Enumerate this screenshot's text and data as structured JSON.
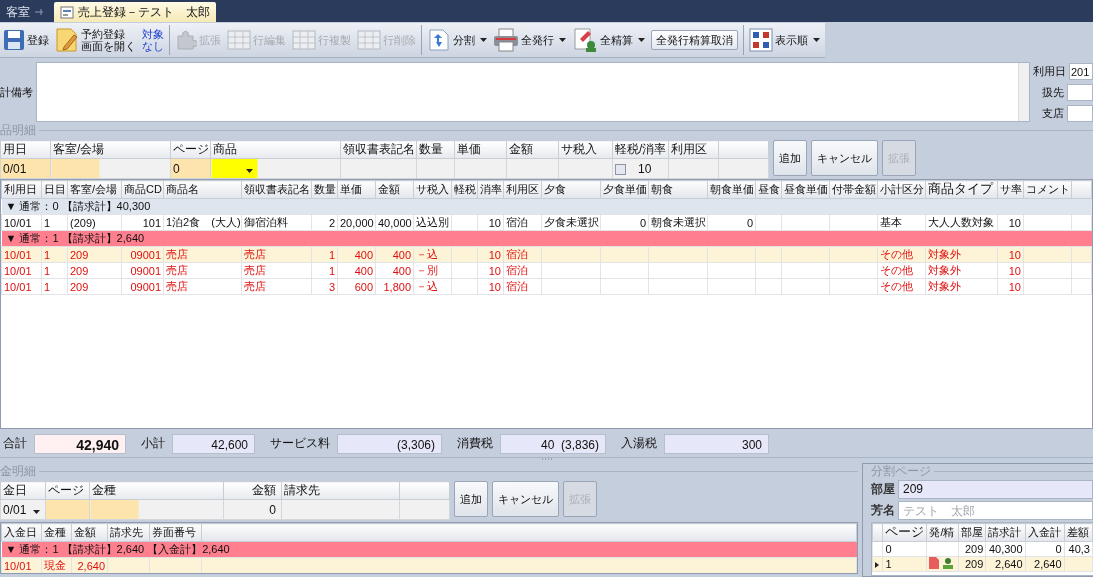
{
  "tabs": [
    {
      "label": "客室",
      "selected": false
    },
    {
      "label": "売上登録－テスト　太郎",
      "selected": true
    }
  ],
  "toolbar": [
    {
      "kind": "icon",
      "lines": [
        "登録"
      ],
      "disabled": false,
      "dropdown": false
    },
    {
      "kind": "icon",
      "lines": [
        "予約登録",
        "画面を開く"
      ],
      "disabled": false,
      "dropdown": false
    },
    {
      "kind": "text",
      "lines": [
        "対象",
        "なし"
      ],
      "disabled": false,
      "dropdown": false
    },
    {
      "kind": "icon",
      "lines": [
        "拡張"
      ],
      "disabled": true,
      "dropdown": false
    },
    {
      "kind": "icon",
      "lines": [
        "行編集"
      ],
      "disabled": true,
      "dropdown": false
    },
    {
      "kind": "icon",
      "lines": [
        "行複製"
      ],
      "disabled": true,
      "dropdown": false
    },
    {
      "kind": "icon",
      "lines": [
        "行削除"
      ],
      "disabled": true,
      "dropdown": false
    },
    {
      "kind": "icon",
      "lines": [
        "分割"
      ],
      "disabled": false,
      "dropdown": true
    },
    {
      "kind": "icon",
      "lines": [
        "全発行"
      ],
      "disabled": false,
      "dropdown": true
    },
    {
      "kind": "icon",
      "lines": [
        "全精算"
      ],
      "disabled": false,
      "dropdown": true
    },
    {
      "kind": "button",
      "lines": [
        "全発行精算取消"
      ],
      "disabled": false,
      "dropdown": false
    },
    {
      "kind": "icon",
      "lines": [
        "表示順"
      ],
      "disabled": false,
      "dropdown": true
    }
  ],
  "memo": {
    "label": "計備考",
    "side_fields": [
      {
        "label": "利用日",
        "value": "201"
      },
      {
        "label": "扱先"
      },
      {
        "label": "支店"
      }
    ]
  },
  "item_entry": {
    "section": "品明細",
    "columns": [
      {
        "label": "用日",
        "value": "0/01",
        "kind": "required"
      },
      {
        "label": "客室/会場",
        "kind": "partial"
      },
      {
        "label": "ページ",
        "value": "0",
        "kind": "required"
      },
      {
        "label": "商品",
        "kind": "active"
      },
      {
        "label": "領収書表記名",
        "kind": "plain"
      },
      {
        "label": "数量",
        "kind": "plain"
      },
      {
        "label": "単価",
        "kind": "plain"
      },
      {
        "label": "金額",
        "kind": "plain"
      },
      {
        "label": "サ税入",
        "kind": "plain"
      },
      {
        "label": "軽税/消率",
        "value": "10",
        "kind": "check",
        "checked": false
      },
      {
        "label": "利用区",
        "kind": "plain"
      }
    ],
    "buttons": [
      {
        "label": "追加",
        "disabled": false
      },
      {
        "label": "キャンセル",
        "disabled": false
      },
      {
        "label": "拡張",
        "disabled": true
      }
    ]
  },
  "items_table": {
    "columns": [
      "利用日",
      "日目",
      "客室/会場",
      "商品CD",
      "商品名",
      "領収書表記名",
      "数量",
      "単価",
      "金額",
      "サ税入",
      "軽税",
      "消率",
      "利用区",
      "夕食",
      "夕食単価",
      "朝食",
      "朝食単価",
      "昼食",
      "昼食単価",
      "付帯金額",
      "小計区分",
      "商品タイプ",
      "サ率",
      "コメント"
    ],
    "groups": [
      {
        "label": "▼ 通常：0 【請求計】40,300",
        "color": "#dfe5ee",
        "rows": [
          {
            "selected": false,
            "warning": false,
            "cells": [
              "10/01",
              "1",
              "(209)",
              "101",
              "1泊2食　(大人)",
              "御宿泊料",
              "2",
              "20,000",
              "40,000",
              "込込別",
              null,
              "10",
              "宿泊",
              "夕食未選択",
              "0",
              "朝食未選択",
              "0",
              null,
              null,
              null,
              "基本",
              "大人人数対象",
              "10",
              null
            ]
          }
        ]
      },
      {
        "label": "▼ 通常：1 【請求計】2,640",
        "color": "#ff7f8f",
        "rows": [
          {
            "selected": true,
            "warning": true,
            "cells": [
              "10/01",
              "1",
              "209",
              "09001",
              "売店",
              "売店",
              "1",
              "400",
              "400",
              "－込",
              null,
              "10",
              "宿泊",
              null,
              null,
              null,
              null,
              null,
              null,
              null,
              "その他",
              "対象外",
              "10",
              null
            ]
          },
          {
            "selected": false,
            "warning": true,
            "cells": [
              "10/01",
              "1",
              "209",
              "09001",
              "売店",
              "売店",
              "1",
              "400",
              "400",
              "－別",
              null,
              "10",
              "宿泊",
              null,
              null,
              null,
              null,
              null,
              null,
              null,
              "その他",
              "対象外",
              "10",
              null
            ]
          },
          {
            "selected": false,
            "warning": true,
            "cells": [
              "10/01",
              "1",
              "209",
              "09001",
              "売店",
              "売店",
              "3",
              "600",
              "1,800",
              "－込",
              null,
              "10",
              "宿泊",
              null,
              null,
              null,
              null,
              null,
              null,
              null,
              "その他",
              "対象外",
              "10",
              null
            ]
          }
        ]
      }
    ]
  },
  "totals": [
    {
      "label": "合計",
      "value": "42,940",
      "kind": "grand"
    },
    {
      "label": "小計",
      "value": "42,600",
      "kind": "sub"
    },
    {
      "label": "サービス料",
      "value": "(3,306)",
      "kind": "sub"
    },
    {
      "label": "消費税",
      "value": "40  (3,836)",
      "kind": "sub"
    },
    {
      "label": "入湯税",
      "value": "300",
      "kind": "sub"
    }
  ],
  "payment_entry": {
    "section": "金明細",
    "columns": [
      {
        "label": "金日",
        "value": "0/01",
        "kind": "dropdown"
      },
      {
        "label": "ページ",
        "kind": "required"
      },
      {
        "label": "金種",
        "kind": "partial"
      },
      {
        "label": "金額",
        "value": "0",
        "kind": "number"
      },
      {
        "label": "請求先",
        "kind": "plain"
      }
    ],
    "buttons": [
      {
        "label": "追加",
        "disabled": false
      },
      {
        "label": "キャンセル",
        "disabled": false
      },
      {
        "label": "拡張",
        "disabled": true
      }
    ]
  },
  "payments_table": {
    "columns": [
      "入金日",
      "金種",
      "金額",
      "請求先",
      "券面番号"
    ],
    "groups": [
      {
        "label": "▼ 通常：1 【請求計】2,640 【入金計】2,640",
        "color": "#ff7f8f",
        "rows": [
          {
            "selected": true,
            "warning": true,
            "cells": [
              "10/01",
              "現金",
              "2,640",
              null,
              null
            ]
          }
        ]
      }
    ]
  },
  "split_pages": {
    "title": "分割ページ",
    "room_label": "部屋",
    "room": "209",
    "name_label": "芳名",
    "name_placeholder": "テスト　太郎",
    "columns": [
      "ページ",
      "発/精",
      "部屋",
      "請求計",
      "入金計",
      "差額"
    ],
    "rows": [
      {
        "selected": false,
        "issued": false,
        "settled": false,
        "cells": [
          "0",
          null,
          "209",
          "40,300",
          "0",
          "40,3"
        ]
      },
      {
        "selected": true,
        "issued": true,
        "settled": true,
        "cells": [
          "1",
          null,
          "209",
          "2,640",
          "2,640",
          null
        ]
      }
    ]
  }
}
